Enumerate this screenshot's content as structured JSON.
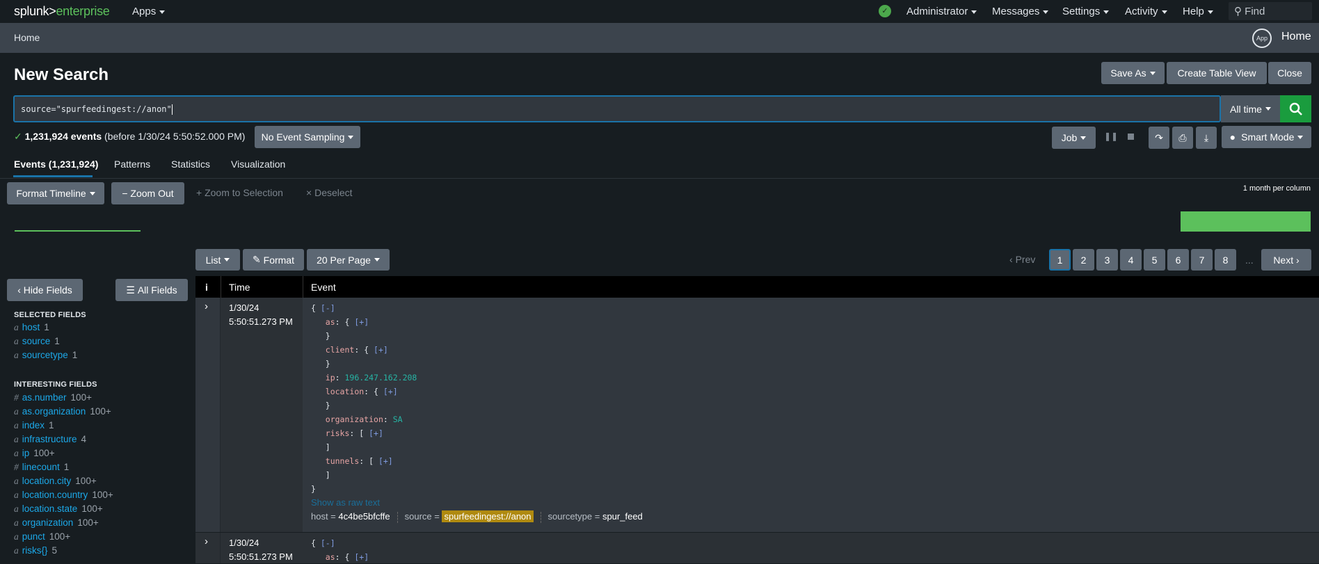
{
  "topbar": {
    "logo_a": "splunk>",
    "logo_b": "enterprise",
    "apps": "Apps",
    "menus": [
      "Administrator",
      "Messages",
      "Settings",
      "Activity",
      "Help"
    ],
    "find": "Find"
  },
  "breadcrumb": {
    "home": "Home",
    "app_badge": "App",
    "app_name": "Home"
  },
  "page": {
    "title": "New Search",
    "save_as": "Save As",
    "create_table": "Create Table View",
    "close": "Close"
  },
  "search": {
    "query": "source=\"spurfeedingest://anon\"",
    "time_range": "All time"
  },
  "status": {
    "count": "1,231,924 events",
    "detail": "(before 1/30/24 5:50:52.000 PM)",
    "sampling": "No Event Sampling",
    "job": "Job",
    "mode": "Smart Mode"
  },
  "tabs": [
    "Events (1,231,924)",
    "Patterns",
    "Statistics",
    "Visualization"
  ],
  "timeline": {
    "format": "Format Timeline",
    "zoom_out": "Zoom Out",
    "zoom_sel": "Zoom to Selection",
    "deselect": "Deselect",
    "scale": "1 month per column"
  },
  "results": {
    "list": "List",
    "format": "Format",
    "per_page": "20 Per Page",
    "prev": "Prev",
    "pages": [
      "1",
      "2",
      "3",
      "4",
      "5",
      "6",
      "7",
      "8"
    ],
    "ellipsis": "...",
    "next": "Next",
    "current_page": 1
  },
  "sidebar": {
    "hide": "Hide Fields",
    "all": "All Fields",
    "selected_title": "SELECTED FIELDS",
    "selected": [
      {
        "t": "a",
        "name": "host",
        "count": "1"
      },
      {
        "t": "a",
        "name": "source",
        "count": "1"
      },
      {
        "t": "a",
        "name": "sourcetype",
        "count": "1"
      }
    ],
    "interesting_title": "INTERESTING FIELDS",
    "interesting": [
      {
        "t": "#",
        "name": "as.number",
        "count": "100+"
      },
      {
        "t": "a",
        "name": "as.organization",
        "count": "100+"
      },
      {
        "t": "a",
        "name": "index",
        "count": "1"
      },
      {
        "t": "a",
        "name": "infrastructure",
        "count": "4"
      },
      {
        "t": "a",
        "name": "ip",
        "count": "100+"
      },
      {
        "t": "#",
        "name": "linecount",
        "count": "1"
      },
      {
        "t": "a",
        "name": "location.city",
        "count": "100+"
      },
      {
        "t": "a",
        "name": "location.country",
        "count": "100+"
      },
      {
        "t": "a",
        "name": "location.state",
        "count": "100+"
      },
      {
        "t": "a",
        "name": "organization",
        "count": "100+"
      },
      {
        "t": "a",
        "name": "punct",
        "count": "100+"
      },
      {
        "t": "a",
        "name": "risks{}",
        "count": "5"
      }
    ]
  },
  "table": {
    "headers": [
      "i",
      "Time",
      "Event"
    ],
    "events": [
      {
        "date": "1/30/24",
        "time": "5:50:51.273 PM",
        "ip": "196.247.162.208",
        "organization": "SA",
        "raw_link": "Show as raw text",
        "host": "4c4be5bfcffe",
        "source": "spurfeedingest://anon",
        "sourcetype": "spur_feed"
      },
      {
        "date": "1/30/24",
        "time": "5:50:51.273 PM"
      }
    ],
    "labels": {
      "collapse": "[-]",
      "expand": "[+]",
      "host": "host =",
      "source": "source =",
      "sourcetype": "sourcetype ="
    }
  }
}
